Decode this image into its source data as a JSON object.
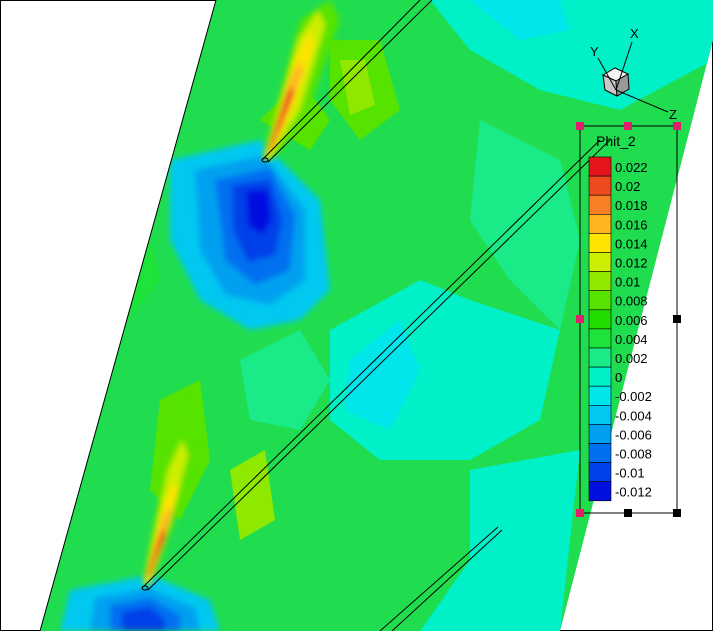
{
  "axes": {
    "x": "X",
    "y": "Y",
    "z": "Z"
  },
  "legend": {
    "title": "Phit_2",
    "levels": [
      {
        "label": "0.022",
        "color": "#e8141b"
      },
      {
        "label": "0.02",
        "color": "#ef4a1f"
      },
      {
        "label": "0.018",
        "color": "#f77f24"
      },
      {
        "label": "0.016",
        "color": "#ffb520"
      },
      {
        "label": "0.014",
        "color": "#ffe400"
      },
      {
        "label": "0.012",
        "color": "#ccee00"
      },
      {
        "label": "0.01",
        "color": "#8fe800"
      },
      {
        "label": "0.008",
        "color": "#56e300"
      },
      {
        "label": "0.006",
        "color": "#22dd00"
      },
      {
        "label": "0.004",
        "color": "#1ee43a"
      },
      {
        "label": "0.002",
        "color": "#1aea88"
      },
      {
        "label": "0",
        "color": "#00f0c8"
      },
      {
        "label": "-0.002",
        "color": "#00e6ea"
      },
      {
        "label": "-0.004",
        "color": "#00c8f0"
      },
      {
        "label": "-0.006",
        "color": "#00a0f0"
      },
      {
        "label": "-0.008",
        "color": "#0070f0"
      },
      {
        "label": "-0.01",
        "color": "#0040e8"
      },
      {
        "label": "-0.012",
        "color": "#0010e0"
      }
    ]
  }
}
